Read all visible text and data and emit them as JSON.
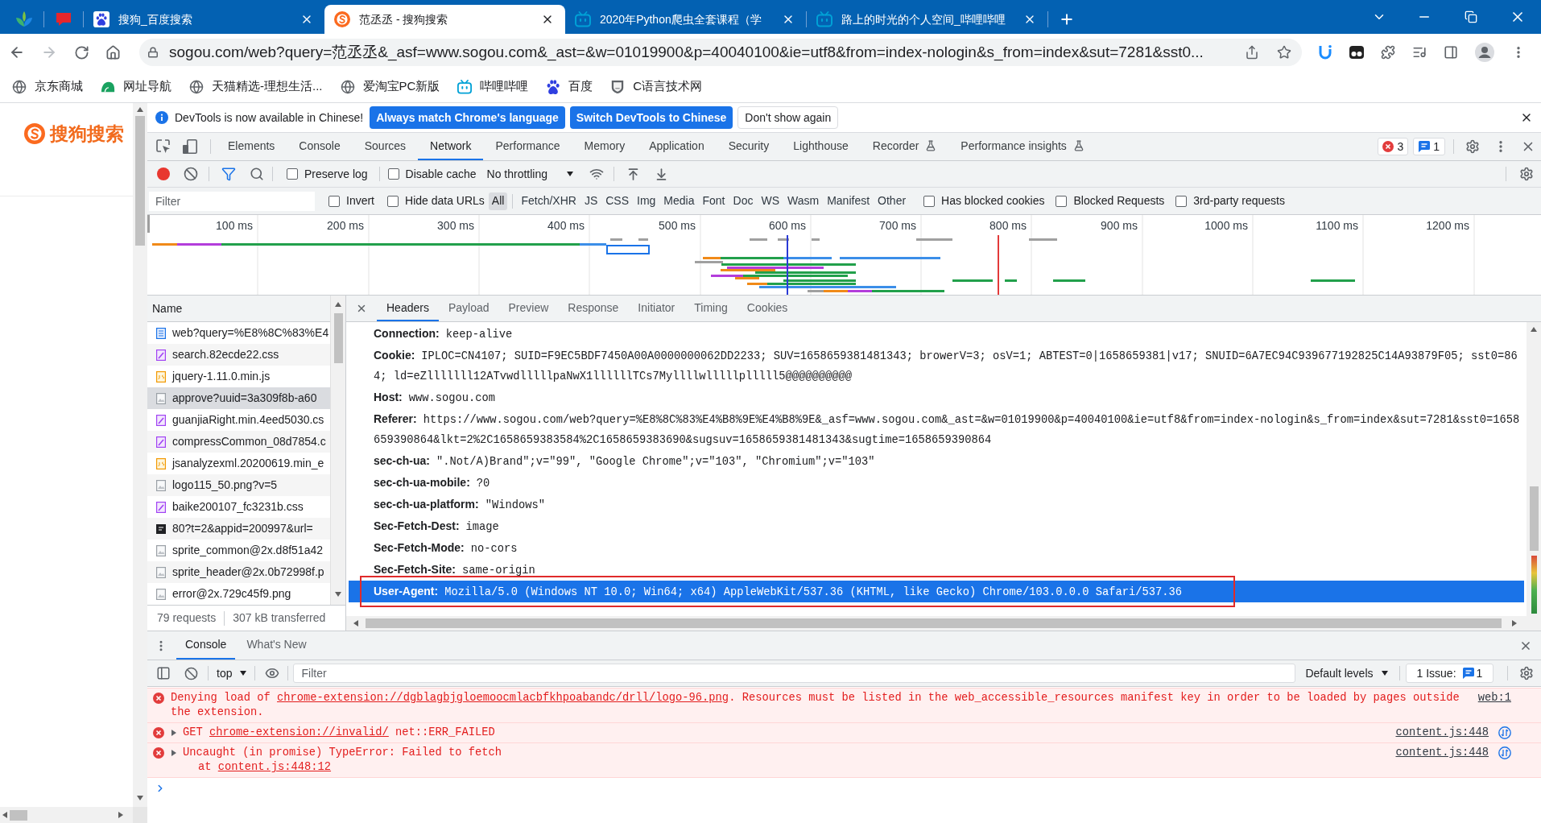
{
  "browser": {
    "tabs": [
      {
        "kind": "pinned",
        "selected": false
      },
      {
        "kind": "pinned",
        "selected": false
      },
      {
        "kind": "page",
        "title": "搜狗_百度搜索",
        "selected": false
      },
      {
        "kind": "page",
        "title": "范丞丞 - 搜狗搜索",
        "selected": true
      },
      {
        "kind": "page",
        "title": "2020年Python爬虫全套课程（学",
        "selected": false
      },
      {
        "kind": "page",
        "title": "路上的时光的个人空间_哔哩哔哩",
        "selected": false
      }
    ],
    "navigation": {
      "back_disabled": false,
      "forward_disabled": true
    },
    "url": "sogou.com/web?query=范丞丞&_asf=www.sogou.com&_ast=&w=01019900&p=40040100&ie=utf8&from=index-nologin&s_from=index&sut=7281&sst0...",
    "bookmarks": [
      "京东商城",
      "网址导航",
      "天猫精选-理想生活...",
      "爱淘宝PC新版",
      "哔哩哔哩",
      "百度",
      "C语言技术网"
    ]
  },
  "page": {
    "logo_text": "搜狗搜索"
  },
  "devtools": {
    "infobar": {
      "message": "DevTools is now available in Chinese!",
      "buttons": [
        {
          "label": "Always match Chrome's language",
          "kind": "primary"
        },
        {
          "label": "Switch DevTools to Chinese",
          "kind": "primary"
        },
        {
          "label": "Don't show again",
          "kind": "secondary"
        }
      ]
    },
    "panels": [
      {
        "label": "Elements",
        "selected": false,
        "experimental": false
      },
      {
        "label": "Console",
        "selected": false,
        "experimental": false
      },
      {
        "label": "Sources",
        "selected": false,
        "experimental": false
      },
      {
        "label": "Network",
        "selected": true,
        "experimental": false
      },
      {
        "label": "Performance",
        "selected": false,
        "experimental": false
      },
      {
        "label": "Memory",
        "selected": false,
        "experimental": false
      },
      {
        "label": "Application",
        "selected": false,
        "experimental": false
      },
      {
        "label": "Security",
        "selected": false,
        "experimental": false
      },
      {
        "label": "Lighthouse",
        "selected": false,
        "experimental": false
      },
      {
        "label": "Recorder",
        "selected": false,
        "experimental": true
      },
      {
        "label": "Performance insights",
        "selected": false,
        "experimental": true
      }
    ],
    "error_count": "3",
    "message_count": "1",
    "network_toolbar": {
      "recording": true,
      "filter_active": true,
      "options": [
        {
          "label": "Preserve log",
          "checked": false
        },
        {
          "label": "Disable cache",
          "checked": false
        }
      ],
      "throttling": "No throttling"
    },
    "filter_bar": {
      "placeholder": "Filter",
      "options": [
        {
          "label": "Invert",
          "checked": false
        },
        {
          "label": "Hide data URLs",
          "checked": false
        }
      ],
      "types": [
        {
          "label": "All",
          "selected": true
        },
        {
          "label": "Fetch/XHR",
          "selected": false
        },
        {
          "label": "JS",
          "selected": false
        },
        {
          "label": "CSS",
          "selected": false
        },
        {
          "label": "Img",
          "selected": false
        },
        {
          "label": "Media",
          "selected": false
        },
        {
          "label": "Font",
          "selected": false
        },
        {
          "label": "Doc",
          "selected": false
        },
        {
          "label": "WS",
          "selected": false
        },
        {
          "label": "Wasm",
          "selected": false
        },
        {
          "label": "Manifest",
          "selected": false
        },
        {
          "label": "Other",
          "selected": false
        }
      ],
      "extra_options": [
        {
          "label": "Has blocked cookies",
          "checked": false
        },
        {
          "label": "Blocked Requests",
          "checked": false
        },
        {
          "label": "3rd-party requests",
          "checked": false
        }
      ]
    },
    "overview": {
      "ticks": [
        "100 ms",
        "200 ms",
        "300 ms",
        "400 ms",
        "500 ms",
        "600 ms",
        "700 ms",
        "800 ms",
        "900 ms",
        "1000 ms",
        "1100 ms",
        "1200 ms"
      ]
    },
    "requests": {
      "column": "Name",
      "rows": [
        {
          "name": "web?query=%E8%8C%83%E4",
          "kind": "document",
          "selected": false
        },
        {
          "name": "search.82ecde22.css",
          "kind": "stylesheet",
          "selected": false
        },
        {
          "name": "jquery-1.11.0.min.js",
          "kind": "script",
          "selected": false
        },
        {
          "name": "approve?uuid=3a309f8b-a60",
          "kind": "image",
          "selected": true
        },
        {
          "name": "guanjiaRight.min.4eed5030.cs",
          "kind": "stylesheet",
          "selected": false
        },
        {
          "name": "compressCommon_08d7854.c",
          "kind": "stylesheet",
          "selected": false
        },
        {
          "name": "jsanalyzexml.20200619.min_e",
          "kind": "script",
          "selected": false
        },
        {
          "name": "logo115_50.png?v=5",
          "kind": "image",
          "selected": false
        },
        {
          "name": "baike200107_fc3231b.css",
          "kind": "stylesheet",
          "selected": false
        },
        {
          "name": "80?t=2&appid=200997&url=",
          "kind": "other",
          "selected": false
        },
        {
          "name": "sprite_common@2x.d8f51a42",
          "kind": "image",
          "selected": false
        },
        {
          "name": "sprite_header@2x.0b72998f.p",
          "kind": "image",
          "selected": false
        },
        {
          "name": "error@2x.729c45f9.png",
          "kind": "image",
          "selected": false
        }
      ],
      "summary": [
        "79 requests",
        "307 kB transferred"
      ]
    },
    "details": {
      "tabs": [
        {
          "label": "Headers",
          "selected": true
        },
        {
          "label": "Payload",
          "selected": false
        },
        {
          "label": "Preview",
          "selected": false
        },
        {
          "label": "Response",
          "selected": false
        },
        {
          "label": "Initiator",
          "selected": false
        },
        {
          "label": "Timing",
          "selected": false
        },
        {
          "label": "Cookies",
          "selected": false
        }
      ],
      "headers": [
        {
          "name": "Connection:",
          "value": "keep-alive",
          "selected": false,
          "annotated": false
        },
        {
          "name": "Cookie:",
          "value": "IPLOC=CN4107; SUID=F9EC5BDF7450A00A0000000062DD2233; SUV=1658659381481343; browerV=3; osV=1; ABTEST=0|1658659381|v17; SNUID=6A7EC94C939677192825C14A93879F05; sst0=864; ld=eZlllllll12ATvwdlllllpaNwX1llllllTCs7Myllllwlllllplllll5@@@@@@@@@@",
          "selected": false,
          "annotated": false
        },
        {
          "name": "Host:",
          "value": "www.sogou.com",
          "selected": false,
          "annotated": false
        },
        {
          "name": "Referer:",
          "value": "https://www.sogou.com/web?query=%E8%8C%83%E4%B8%9E%E4%B8%9E&_asf=www.sogou.com&_ast=&w=01019900&p=40040100&ie=utf8&from=index-nologin&s_from=index&sut=7281&sst0=1658659390864&lkt=2%2C1658659383584%2C1658659383690&sugsuv=1658659381481343&sugtime=1658659390864",
          "selected": false,
          "annotated": false
        },
        {
          "name": "sec-ch-ua:",
          "value": "\".Not/A)Brand\";v=\"99\", \"Google Chrome\";v=\"103\", \"Chromium\";v=\"103\"",
          "selected": false,
          "annotated": false
        },
        {
          "name": "sec-ch-ua-mobile:",
          "value": "?0",
          "selected": false,
          "annotated": false
        },
        {
          "name": "sec-ch-ua-platform:",
          "value": "\"Windows\"",
          "selected": false,
          "annotated": false
        },
        {
          "name": "Sec-Fetch-Dest:",
          "value": "image",
          "selected": false,
          "annotated": false
        },
        {
          "name": "Sec-Fetch-Mode:",
          "value": "no-cors",
          "selected": false,
          "annotated": false
        },
        {
          "name": "Sec-Fetch-Site:",
          "value": "same-origin",
          "selected": false,
          "annotated": false
        },
        {
          "name": "User-Agent:",
          "value": "Mozilla/5.0 (Windows NT 10.0; Win64; x64) AppleWebKit/537.36 (KHTML, like Gecko) Chrome/103.0.0.0 Safari/537.36",
          "selected": true,
          "annotated": true
        }
      ]
    },
    "drawer": {
      "tabs": [
        {
          "label": "Console",
          "selected": true
        },
        {
          "label": "What's New",
          "selected": false
        }
      ],
      "context": "top",
      "filter_placeholder": "Filter",
      "levels": "Default levels",
      "issues_label": "1 Issue:",
      "issues_count": "1",
      "messages": [
        {
          "kind": "error",
          "expandable": false,
          "parts": [
            {
              "kind": "text",
              "text": "Denying load of "
            },
            {
              "kind": "link",
              "text": "chrome-extension://dgblagbjgloemoocmlacbfkhpoabandc/drll/logo-96.png"
            },
            {
              "kind": "text",
              "text": ". Resources must be listed in the web_accessible_resources manifest key in order to be loaded by pages outside the extension."
            }
          ],
          "source": "web:1",
          "source_badge": false
        },
        {
          "kind": "error",
          "expandable": true,
          "parts": [
            {
              "kind": "text",
              "text": "GET "
            },
            {
              "kind": "link",
              "text": "chrome-extension://invalid/"
            },
            {
              "kind": "text",
              "text": " net::ERR_FAILED"
            }
          ],
          "source": "content.js:448",
          "source_badge": true
        },
        {
          "kind": "error",
          "expandable": true,
          "parts": [
            {
              "kind": "text",
              "text": "Uncaught (in promise) TypeError: Failed to fetch"
            }
          ],
          "stack": [
            {
              "kind": "text",
              "text": "at "
            },
            {
              "kind": "link",
              "text": "content.js:448:12"
            }
          ],
          "source": "content.js:448",
          "source_badge": true
        }
      ]
    }
  }
}
